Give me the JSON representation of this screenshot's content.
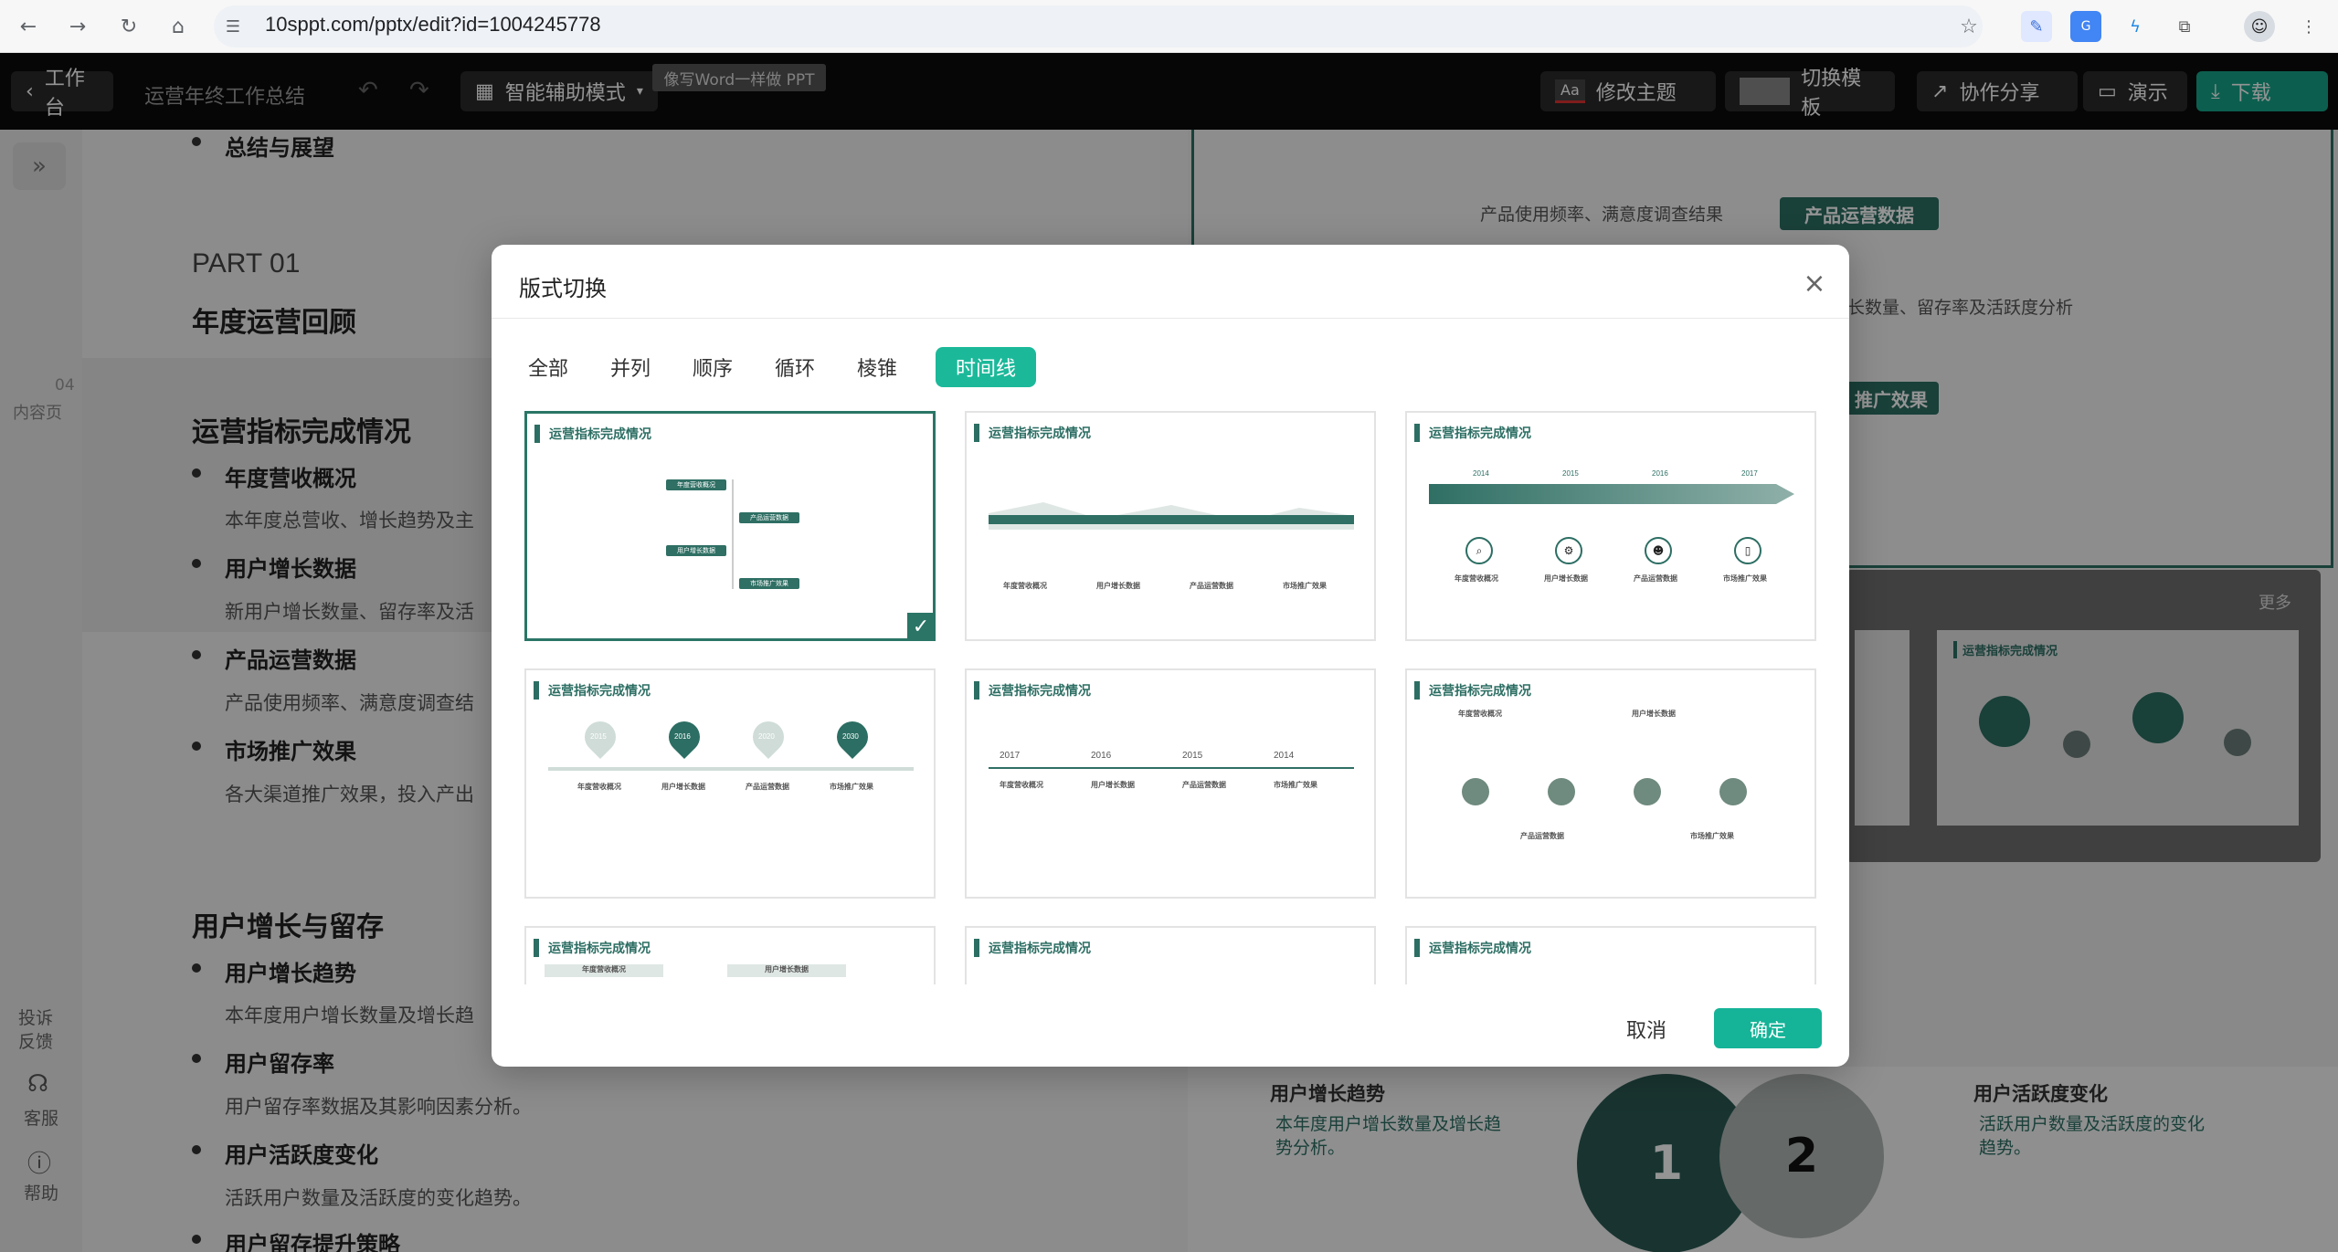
{
  "browser": {
    "url": "10sppt.com/pptx/edit?id=1004245778"
  },
  "toolbar": {
    "back_label": "工作台",
    "doc_title": "运营年终工作总结",
    "mode_label": "智能辅助模式",
    "tooltip": "像写Word一样做 PPT",
    "theme_label": "修改主题",
    "theme_icon_text": "Aa",
    "template_label": "切换模板",
    "share_label": "协作分享",
    "present_label": "演示",
    "download_label": "下载"
  },
  "rail": {
    "page_num": "04",
    "page_type": "内容页",
    "feedback": "投诉\n反馈",
    "service": "客服",
    "help": "帮助"
  },
  "doc": {
    "summary_item": "总结与展望",
    "part": "PART 01",
    "part_title": "年度运营回顾",
    "section1": "运营指标完成情况",
    "items1": [
      {
        "title": "年度营收概况",
        "sub": "本年度总营收、增长趋势及主"
      },
      {
        "title": "用户增长数据",
        "sub": "新用户增长数量、留存率及活"
      },
      {
        "title": "产品运营数据",
        "sub": "产品使用频率、满意度调查结"
      },
      {
        "title": "市场推广效果",
        "sub": "各大渠道推广效果，投入产出"
      }
    ],
    "section2": "用户增长与留存",
    "items2": [
      {
        "title": "用户增长趋势",
        "sub": "本年度用户增长数量及增长趋"
      },
      {
        "title": "用户留存率",
        "sub": "用户留存率数据及其影响因素分析。"
      },
      {
        "title": "用户活跃度变化",
        "sub": "活跃用户数量及活跃度的变化趋势。"
      },
      {
        "title": "用户留存提升策略",
        "sub": ""
      }
    ]
  },
  "slide_right": {
    "line1": "产品使用频率、满意度调查结果",
    "badge1": "产品运营数据",
    "line2": "长数量、留存率及活跃度分析",
    "badge2": "推广效果",
    "more": "更多",
    "preview_title": "运营指标完成情况",
    "card_left_title": "用户增长趋势",
    "card_left_text": "本年度用户增长数量及增长趋势分析。",
    "card_right_title": "用户活跃度变化",
    "card_right_text": "活跃用户数量及活跃度的变化趋势。",
    "circle1": "1",
    "circle2": "2"
  },
  "modal": {
    "title": "版式切换",
    "tabs": [
      "全部",
      "并列",
      "顺序",
      "循环",
      "棱锥",
      "时间线"
    ],
    "active_tab": "时间线",
    "card_title": "运营指标完成情况",
    "cancel": "取消",
    "confirm": "确定",
    "years_a": [
      "2014",
      "2015",
      "2016",
      "2017"
    ],
    "years_b": [
      "2015",
      "2016",
      "2020",
      "2030"
    ],
    "years_c": [
      "2017",
      "2016",
      "2015",
      "2014"
    ],
    "items": [
      "年度营收概况",
      "用户增长数据",
      "产品运营数据",
      "市场推广效果"
    ]
  },
  "colors": {
    "accent": "#1bb99a",
    "theme": "#2c6e63",
    "download": "#15a489"
  }
}
